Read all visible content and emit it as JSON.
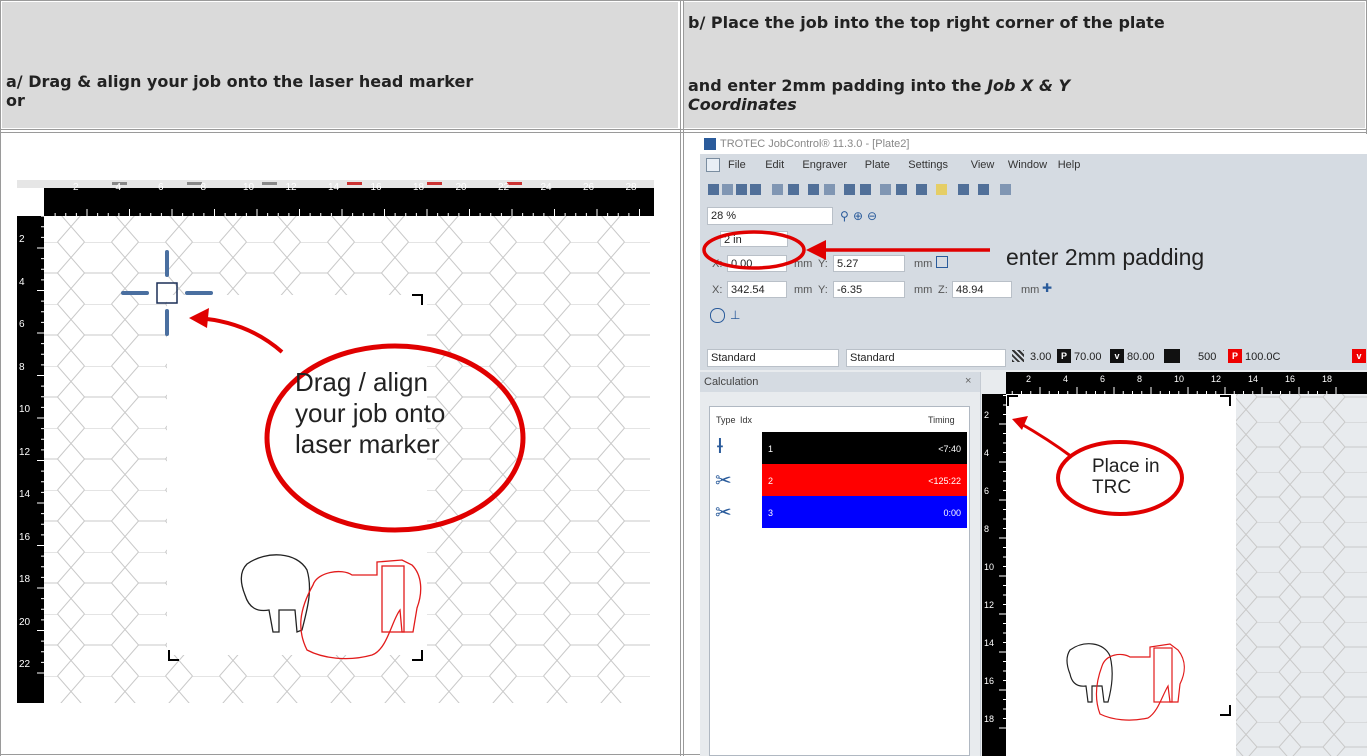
{
  "headers": {
    "left": "a/ Drag & align your job onto the laser head marker or",
    "left_line1": "a/ Drag & align your job onto the laser head marker",
    "left_line2": "or",
    "right_line1": "b/ Place the job into the top right corner of the plate",
    "right_line2_prefix": "and enter 2mm padding into the ",
    "right_line2_em": "Job X & Y",
    "right_line3_em": "Coordinates"
  },
  "left_image": {
    "ruler_top": [
      "2",
      "4",
      "6",
      "8",
      "10",
      "12",
      "14",
      "16",
      "18",
      "20",
      "22",
      "24",
      "26",
      "28"
    ],
    "ruler_left": [
      "2",
      "4",
      "6",
      "8",
      "10",
      "12",
      "14",
      "16",
      "18",
      "20",
      "22"
    ],
    "callout_line1": "Drag / align",
    "callout_line2": "your job onto",
    "callout_line3": "laser marker"
  },
  "right_image": {
    "window_title": "TROTEC JobControl® 11.3.0 - [Plate2]",
    "menu": [
      "File",
      "Edit",
      "Engraver",
      "Plate",
      "Settings",
      "View",
      "Window",
      "Help"
    ],
    "zoom": "28 %",
    "padding_field": "2 in",
    "x1_label": "X:",
    "x1_value": "0.00",
    "y1_value": "5.27",
    "unit": "mm",
    "x2_value": "342.54",
    "y2_value": "-6.35",
    "z_value": "48.94",
    "y_label": "Y:",
    "z_label": "Z:",
    "material1": "Standard",
    "material2": "Standard",
    "param1": "3.00",
    "param2": "70.00",
    "param3": "80.00",
    "param4": "500",
    "param5": "100.0C",
    "panel_title": "Calculation",
    "col_type": "Type",
    "col_idx": "Idx",
    "col_timing": "Timing",
    "rows": [
      {
        "idx": "1",
        "timing": "<7:40",
        "color": "#000000"
      },
      {
        "idx": "2",
        "timing": "<125:22",
        "color": "#ff0000"
      },
      {
        "idx": "3",
        "timing": "0:00",
        "color": "#0000ff"
      }
    ],
    "ruler_top": [
      "2",
      "4",
      "6",
      "8",
      "10",
      "12",
      "14",
      "16",
      "18"
    ],
    "ruler_left": [
      "2",
      "4",
      "6",
      "8",
      "10",
      "12",
      "14",
      "16",
      "18"
    ],
    "annot_padding": "enter 2mm padding",
    "callout_line1": "Place in",
    "callout_line2": "TRC"
  }
}
